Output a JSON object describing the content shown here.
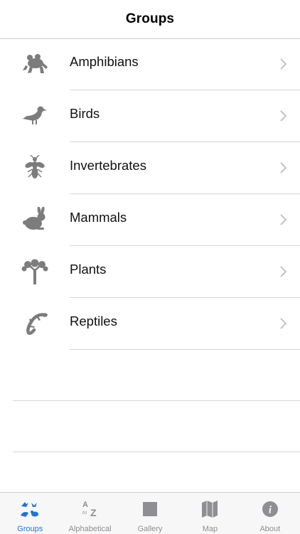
{
  "header": {
    "title": "Groups"
  },
  "groups": [
    {
      "label": "Amphibians",
      "icon": "frog-icon"
    },
    {
      "label": "Birds",
      "icon": "bird-icon"
    },
    {
      "label": "Invertebrates",
      "icon": "insect-icon"
    },
    {
      "label": "Mammals",
      "icon": "rabbit-icon"
    },
    {
      "label": "Plants",
      "icon": "joshua-tree-icon"
    },
    {
      "label": "Reptiles",
      "icon": "lizard-icon"
    }
  ],
  "tabbar": {
    "items": [
      {
        "label": "Groups",
        "icon": "groups-icon",
        "active": true
      },
      {
        "label": "Alphabetical",
        "icon": "a-to-z-icon",
        "active": false
      },
      {
        "label": "Gallery",
        "icon": "gallery-icon",
        "active": false
      },
      {
        "label": "Map",
        "icon": "map-icon",
        "active": false
      },
      {
        "label": "About",
        "icon": "info-icon",
        "active": false
      }
    ],
    "a_to_z_glyphs": {
      "a": "A",
      "to": "to",
      "z": "Z"
    },
    "info_glyph": "i"
  },
  "colors": {
    "accent": "#1f74d6",
    "icon_gray": "#7c7c7c",
    "tab_inactive": "#8e8e93",
    "separator": "#d6d6da",
    "chevron": "#c4c4c7"
  }
}
